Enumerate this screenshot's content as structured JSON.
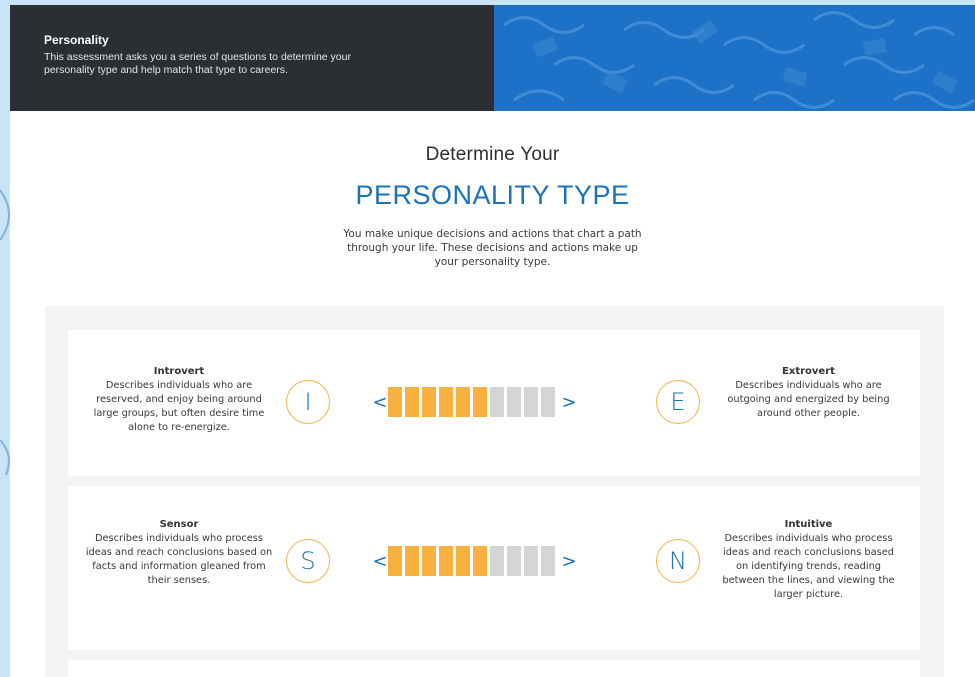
{
  "banner": {
    "title": "Personality",
    "description": "This assessment asks you a series of questions to determine your personality type and help match that type to careers."
  },
  "intro": {
    "eyebrow": "Determine Your",
    "heading": "PERSONALITY TYPE",
    "description": "You make unique decisions and actions that chart a path through your life. These decisions and actions make up your personality type."
  },
  "colors": {
    "accent_blue": "#1a73b8",
    "segment_active": "#f8b03e",
    "segment_inactive": "#d3d5d7",
    "circle_border": "#f5b445"
  },
  "icons": {
    "left_arrow": "chevron-left-icon",
    "right_arrow": "chevron-right-icon"
  },
  "traits": [
    {
      "left_name": "Introvert",
      "left_desc": "Describes individuals who are reserved, and enjoy being around large groups, but often desire time alone to re-energize.",
      "left_letter": "I",
      "right_letter": "E",
      "right_name": "Extrovert",
      "right_desc": "Describes individuals who are outgoing and energized by being around other people.",
      "arrow_left": "<",
      "arrow_right": ">",
      "segments_total": 10,
      "segments_filled": 6
    },
    {
      "left_name": "Sensor",
      "left_desc": "Describes individuals who process ideas and reach conclusions based on facts and information gleaned from their senses.",
      "left_letter": "S",
      "right_letter": "N",
      "right_name": "Intuitive",
      "right_desc": "Describes individuals who process ideas and reach conclusions based on identifying trends, reading between the lines, and viewing the larger picture.",
      "arrow_left": "<",
      "arrow_right": ">",
      "segments_total": 10,
      "segments_filled": 6
    }
  ]
}
